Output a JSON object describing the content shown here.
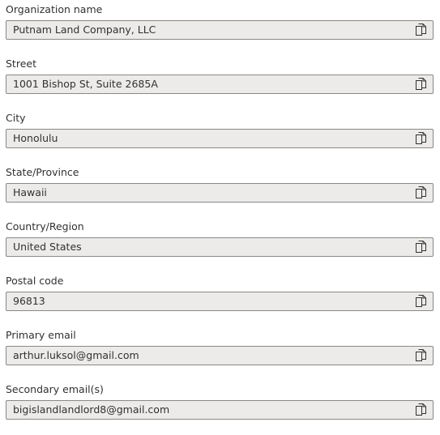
{
  "fields": [
    {
      "label": "Organization name",
      "value": "Putnam Land Company, LLC"
    },
    {
      "label": "Street",
      "value": "1001 Bishop St, Suite 2685A"
    },
    {
      "label": "City",
      "value": "Honolulu"
    },
    {
      "label": "State/Province",
      "value": "Hawaii"
    },
    {
      "label": "Country/Region",
      "value": "United States"
    },
    {
      "label": "Postal code",
      "value": "96813"
    },
    {
      "label": "Primary email",
      "value": "arthur.luksol@gmail.com"
    },
    {
      "label": "Secondary email(s)",
      "value": "bigislandlandlord8@gmail.com"
    }
  ],
  "icons": {
    "copy": "copy-icon"
  },
  "colors": {
    "field_background": "#edebe9",
    "field_border": "#8a8886",
    "text": "#323130"
  }
}
